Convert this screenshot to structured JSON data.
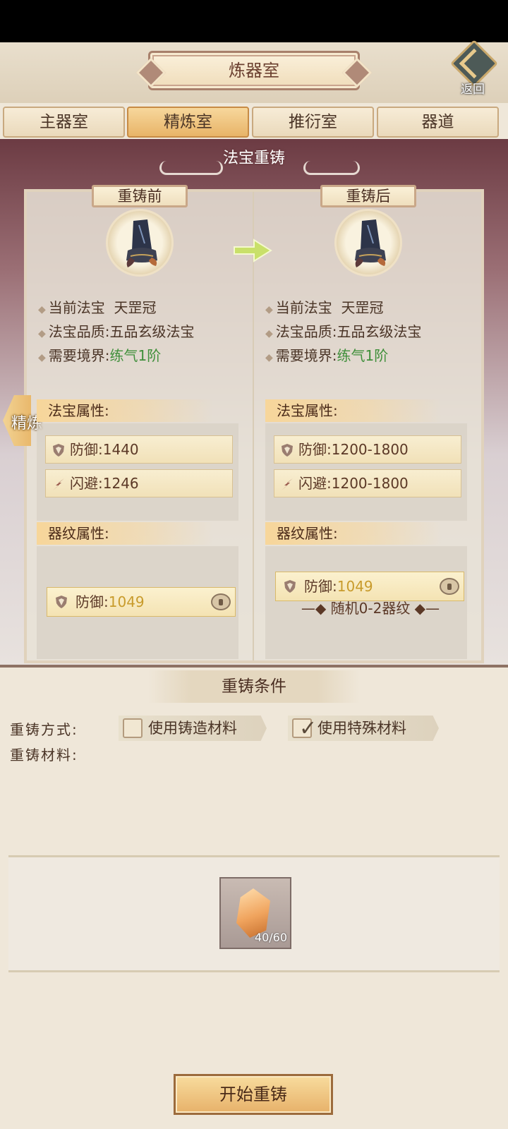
{
  "header": {
    "title": "炼器室",
    "back_label": "返回"
  },
  "tabs": [
    {
      "label": "主器室",
      "active": false
    },
    {
      "label": "精炼室",
      "active": true
    },
    {
      "label": "推衍室",
      "active": false
    },
    {
      "label": "器道",
      "active": false
    }
  ],
  "section_title": "法宝重铸",
  "side_tab_label": "精炼",
  "before": {
    "header": "重铸前",
    "current_label": "当前法宝",
    "current_value": "天罡冠",
    "quality_label": "法宝品质:",
    "quality_value": "五品玄级法宝",
    "realm_label": "需要境界:",
    "realm_value": "练气1阶",
    "attr_heading": "法宝属性:",
    "attrs": [
      {
        "icon": "shield-icon",
        "label": "防御:",
        "value": "1440"
      },
      {
        "icon": "dodge-icon",
        "label": "闪避:",
        "value": "1246"
      }
    ],
    "glyph_heading": "器纹属性:",
    "glyphs": [
      {
        "icon": "shield-icon",
        "label": "防御:",
        "value": "1049"
      }
    ]
  },
  "after": {
    "header": "重铸后",
    "current_label": "当前法宝",
    "current_value": "天罡冠",
    "quality_label": "法宝品质:",
    "quality_value": "五品玄级法宝",
    "realm_label": "需要境界:",
    "realm_value": "练气1阶",
    "attr_heading": "法宝属性:",
    "attrs": [
      {
        "icon": "shield-icon",
        "label": "防御:",
        "value": "1200-1800"
      },
      {
        "icon": "dodge-icon",
        "label": "闪避:",
        "value": "1200-1800"
      }
    ],
    "glyph_heading": "器纹属性:",
    "glyphs": [
      {
        "icon": "shield-icon",
        "label": "防御:",
        "value": "1049"
      }
    ],
    "random_note": "随机0-2器纹"
  },
  "conditions": {
    "title": "重铸条件",
    "method_label": "重铸方式:",
    "material_label": "重铸材料:",
    "options": [
      {
        "label": "使用铸造材料",
        "checked": false
      },
      {
        "label": "使用特殊材料",
        "checked": true
      }
    ],
    "material": {
      "icon": "orange-gem-icon",
      "count": "40/60"
    }
  },
  "start_button": "开始重铸",
  "colors": {
    "accent": "#e8b468",
    "green_text": "#3f8f3a",
    "gold_value": "#c89b2c"
  }
}
